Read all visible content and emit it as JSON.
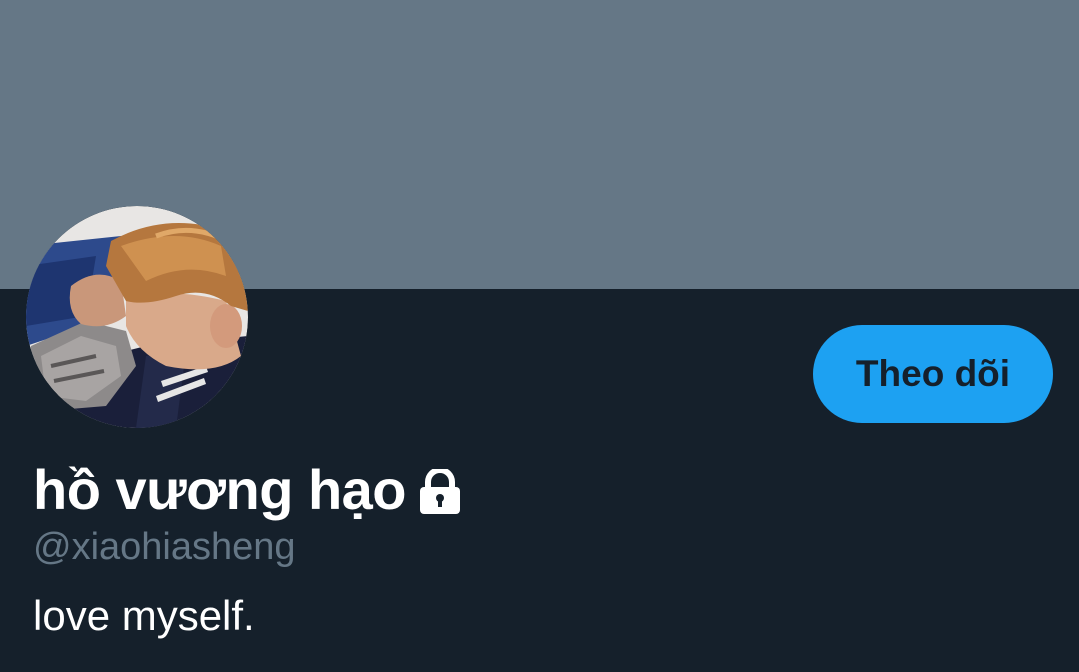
{
  "profile": {
    "display_name": "hồ vương hạo",
    "handle": "@xiaohiasheng",
    "bio": "love myself.",
    "follow_label": "Theo dõi",
    "protected_icon": "lock-icon"
  },
  "colors": {
    "banner": "#657786",
    "background": "#15202b",
    "accent": "#1da1f2",
    "secondary_text": "#657786",
    "primary_text": "#ffffff"
  }
}
